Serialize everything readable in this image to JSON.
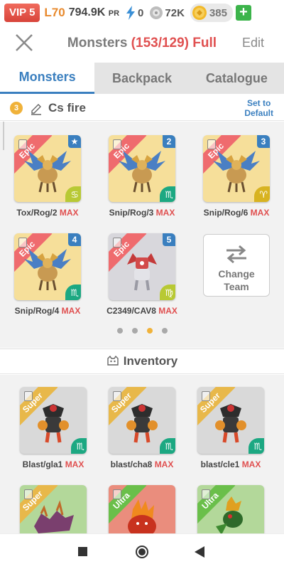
{
  "status": {
    "vip": "VIP 5",
    "level": "L70",
    "pr_value": "794.9K",
    "pr_unit": "PR",
    "energy": "0",
    "food": "72K",
    "gold": "385",
    "plus": "+"
  },
  "header": {
    "title": "Monsters",
    "count": "(153/129) Full",
    "edit": "Edit"
  },
  "tabs": [
    {
      "label": "Monsters",
      "active": true
    },
    {
      "label": "Backpack",
      "active": false
    },
    {
      "label": "Catalogue",
      "active": false
    }
  ],
  "team": {
    "number": "3",
    "name": "Cs fire",
    "set_default_line1": "Set to",
    "set_default_line2": "Default"
  },
  "team_monsters": [
    {
      "name": "Tox/Rog/2",
      "max": "MAX",
      "rarity": "Epic",
      "badge": "★",
      "zodiac": "♋"
    },
    {
      "name": "Snip/Rog/3",
      "max": "MAX",
      "rarity": "Epic",
      "badge": "2",
      "zodiac": "♏"
    },
    {
      "name": "Snip/Rog/6",
      "max": "MAX",
      "rarity": "Epic",
      "badge": "3",
      "zodiac": "♈"
    },
    {
      "name": "Snip/Rog/4",
      "max": "MAX",
      "rarity": "Epic",
      "badge": "4",
      "zodiac": "♏"
    },
    {
      "name": "C2349/CAV8",
      "max": "MAX",
      "rarity": "Epic",
      "badge": "5",
      "zodiac": "♍"
    }
  ],
  "change_team": {
    "line1": "Change",
    "line2": "Team"
  },
  "pager": {
    "count": 4,
    "active_index": 2
  },
  "inventory": {
    "title": "Inventory",
    "items": [
      {
        "name": "Blast/gla1",
        "max": "MAX",
        "rarity": "Super",
        "zodiac": "♏"
      },
      {
        "name": "blast/cha8",
        "max": "MAX",
        "rarity": "Super",
        "zodiac": "♏"
      },
      {
        "name": "blast/cle1",
        "max": "MAX",
        "rarity": "Super",
        "zodiac": "♏"
      },
      {
        "name": "",
        "max": "",
        "rarity": "Super",
        "zodiac": ""
      },
      {
        "name": "",
        "max": "",
        "rarity": "Ultra",
        "zodiac": ""
      },
      {
        "name": "",
        "max": "",
        "rarity": "Ultra",
        "zodiac": ""
      }
    ]
  },
  "colors": {
    "accent_blue": "#3a7fbf",
    "full_red": "#e05050",
    "epic_ribbon": "#ef6b6e",
    "super_ribbon": "#e8b84a",
    "ultra_ribbon": "#6abf4a"
  }
}
